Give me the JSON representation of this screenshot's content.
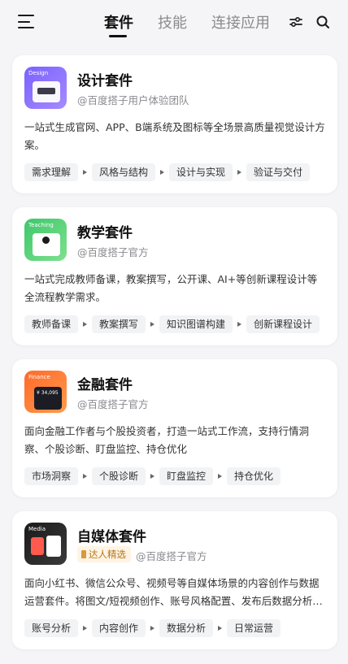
{
  "header": {
    "tabs": [
      {
        "label": "套件",
        "active": true
      },
      {
        "label": "技能",
        "active": false
      },
      {
        "label": "连接应用",
        "active": false
      }
    ],
    "icons": [
      "menu-icon",
      "filter-icon",
      "search-icon"
    ]
  },
  "colors": {
    "accent": "#111111",
    "muted": "#8a8a8f",
    "badge_bg": "#fff4e4",
    "badge_text": "#b8741a"
  },
  "cards": [
    {
      "thumb_label": "Design",
      "title": "设计套件",
      "author": "@百度搭子用户体验团队",
      "description": "一站式生成官网、APP、B端系统及图标等全场景高质量视觉设计方案。",
      "steps": [
        "需求理解",
        "风格与结构",
        "设计与实现",
        "验证与交付"
      ]
    },
    {
      "thumb_label": "Teaching",
      "title": "教学套件",
      "author": "@百度搭子官方",
      "description": "一站式完成教师备课，教案撰写，公开课、AI+等创新课程设计等全流程教学需求。",
      "steps": [
        "教师备课",
        "教案撰写",
        "知识图谱构建",
        "创新课程设计"
      ]
    },
    {
      "thumb_label": "Finance",
      "thumb_text": "¥ 34,095",
      "title": "金融套件",
      "author": "@百度搭子官方",
      "description": "面向金融工作者与个股投资者，打造一站式工作流，支持行情洞察、个股诊断、盯盘监控、持仓优化",
      "steps": [
        "市场洞察",
        "个股诊断",
        "盯盘监控",
        "持仓优化"
      ]
    },
    {
      "thumb_label": "Media",
      "title": "自媒体套件",
      "badge": "达人精选",
      "author": "@百度搭子官方",
      "description": "面向小红书、微信公众号、视频号等自媒体场景的内容创作与数据运营套件。将图文/短视频创作、账号风格配置、发布后数据分析等环节串联为一体。",
      "steps": [
        "账号分析",
        "内容创作",
        "数据分析",
        "日常运营"
      ]
    }
  ]
}
